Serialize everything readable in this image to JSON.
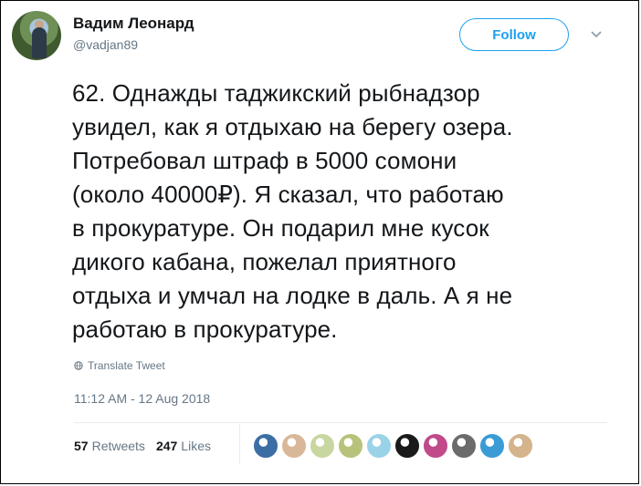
{
  "author": {
    "name": "Вадим Леонард",
    "handle": "@vadjan89"
  },
  "follow_label": "Follow",
  "tweet": {
    "text": "62. Однажды таджикский рыбнадзор\nувидел, как я отдыхаю на берегу озера.\nПотребовал штраф в 5000 сомони\n(около 40000₽). Я сказал, что работаю\nв прокуратуре. Он подарил мне кусок\nдикого кабана, пожелал приятного\nотдыха и умчал на лодке в даль. А я не\nработаю в прокуратуре.",
    "translate_label": "Translate Tweet",
    "timestamp": "11:12 AM - 12 Aug 2018"
  },
  "stats": {
    "retweets_count": "57",
    "retweets_label": "Retweets",
    "likes_count": "247",
    "likes_label": "Likes"
  },
  "likers": [
    {
      "color": "#3b6ea5"
    },
    {
      "color": "#d9b89a"
    },
    {
      "color": "#c8d6a0"
    },
    {
      "color": "#b9c27a"
    },
    {
      "color": "#9ad3e8"
    },
    {
      "color": "#1a1a1a"
    },
    {
      "color": "#c04a8a"
    },
    {
      "color": "#6b6b6b"
    },
    {
      "color": "#3a9bd5"
    },
    {
      "color": "#d4b48c"
    }
  ],
  "colors": {
    "accent": "#1da1f2",
    "secondary_text": "#657786"
  }
}
